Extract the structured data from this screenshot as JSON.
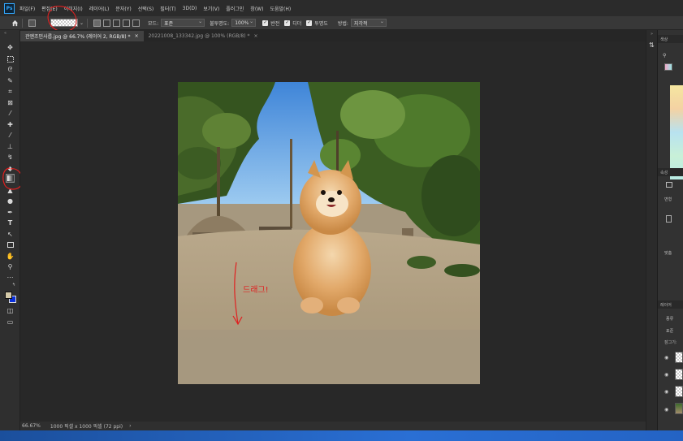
{
  "app": {
    "logo": "Ps"
  },
  "menubar": {
    "items": [
      "파일(F)",
      "편집(E)",
      "이미지(I)",
      "레이어(L)",
      "문자(Y)",
      "선택(S)",
      "필터(T)",
      "3D(D)",
      "보기(V)",
      "플러그인",
      "창(W)",
      "도움말(H)"
    ]
  },
  "options": {
    "mode_label": "모드:",
    "mode_value": "표준",
    "opacity_label": "불투명도:",
    "opacity_value": "100%",
    "reverse_label": "반전",
    "dither_label": "디더",
    "transparency_label": "투명도",
    "method_label": "방법:",
    "method_value": "지각적"
  },
  "tabs": [
    {
      "label": "관엔조민사롭.jpg @ 66.7% (레이어 2, RGB/8) *",
      "close": "×"
    },
    {
      "label": "20221008_133342.jpg @ 100% (RGB/8) *",
      "close": "×"
    }
  ],
  "status": {
    "zoom": "66.67%",
    "doc_info": "1000 픽셀 x 1000 픽셀 (72 ppi)",
    "arrow": "›"
  },
  "annotation": {
    "drag_text": "드래그!"
  },
  "panels": {
    "color_tab": "색상",
    "props_tab": "속성",
    "transform_label": "변형",
    "align_label": "맞춤",
    "layers_tab": "레이어",
    "kind_label": "종류",
    "normal_label": "표준",
    "lock_label": "잠그기:"
  },
  "colors": {
    "accent": "#31a8ff",
    "annotation_red": "#e02020",
    "background_color_swatch": "#0a2fd8",
    "foreground_color_swatch": "#ffffff"
  },
  "icons": [
    "home-icon",
    "move-icon",
    "marquee-icon",
    "lasso-icon",
    "quick-select-icon",
    "crop-icon",
    "frame-icon",
    "eyedropper-icon",
    "healing-icon",
    "brush-icon",
    "stamp-icon",
    "history-brush-icon",
    "eraser-icon",
    "gradient-icon",
    "blur-icon",
    "dodge-icon",
    "pen-icon",
    "type-icon",
    "path-select-icon",
    "rectangle-icon",
    "hand-icon",
    "zoom-icon",
    "eye-icon"
  ]
}
